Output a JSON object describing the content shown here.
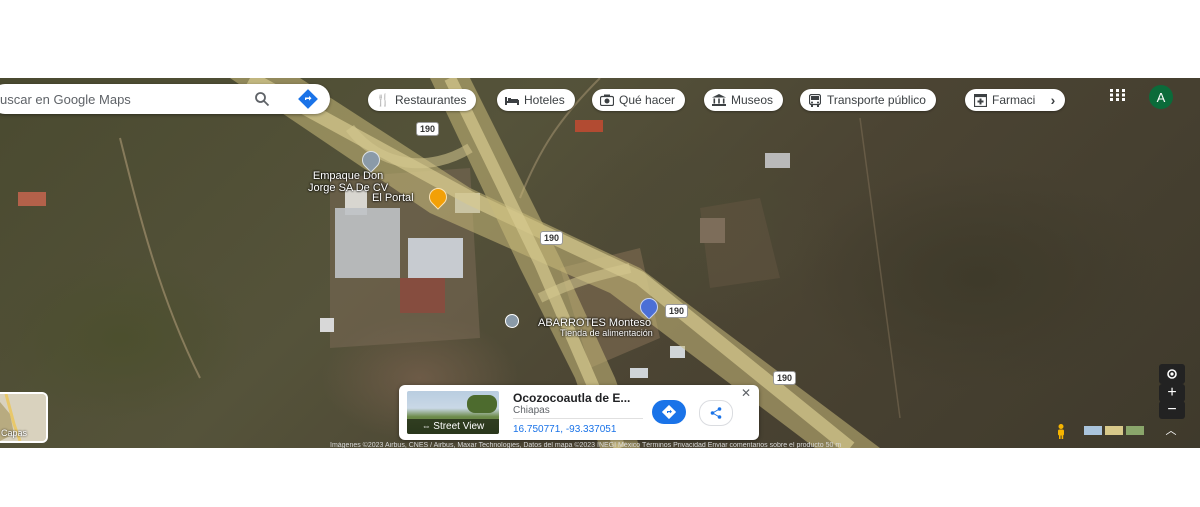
{
  "search": {
    "placeholder": "uscar en Google Maps"
  },
  "chips": [
    {
      "label": "Restaurantes",
      "icon": "fork-knife-icon"
    },
    {
      "label": "Hoteles",
      "icon": "bed-icon"
    },
    {
      "label": "Qué hacer",
      "icon": "camera-icon"
    },
    {
      "label": "Museos",
      "icon": "museum-icon"
    },
    {
      "label": "Transporte público",
      "icon": "bus-icon"
    },
    {
      "label": "Farmaci",
      "icon": "pharmacy-icon"
    }
  ],
  "account": {
    "initial": "A"
  },
  "map": {
    "labels": {
      "empaque": "Empaque Don\nJorge SA De CV",
      "portal": "El Portal",
      "abarrotes": "ABARROTES Monteso",
      "abarrotes_sub": "Tienda de alimentación"
    },
    "route": "190"
  },
  "card": {
    "title": "Ocozocoautla de E...",
    "subtitle": "Chiapas",
    "coords": "16.750771, -93.337051",
    "street_view_label": "Street View"
  },
  "layers": {
    "label": "Capas"
  },
  "footer": "Imágenes ©2023 Airbus, CNES / Airbus, Maxar Technologies, Datos del mapa ©2023 INEGI   México   Términos   Privacidad   Enviar comentarios sobre el producto   50 m",
  "colors": {
    "accent": "#1a73e8",
    "avatar": "#0b6b3a",
    "road": "#c9b97a"
  }
}
